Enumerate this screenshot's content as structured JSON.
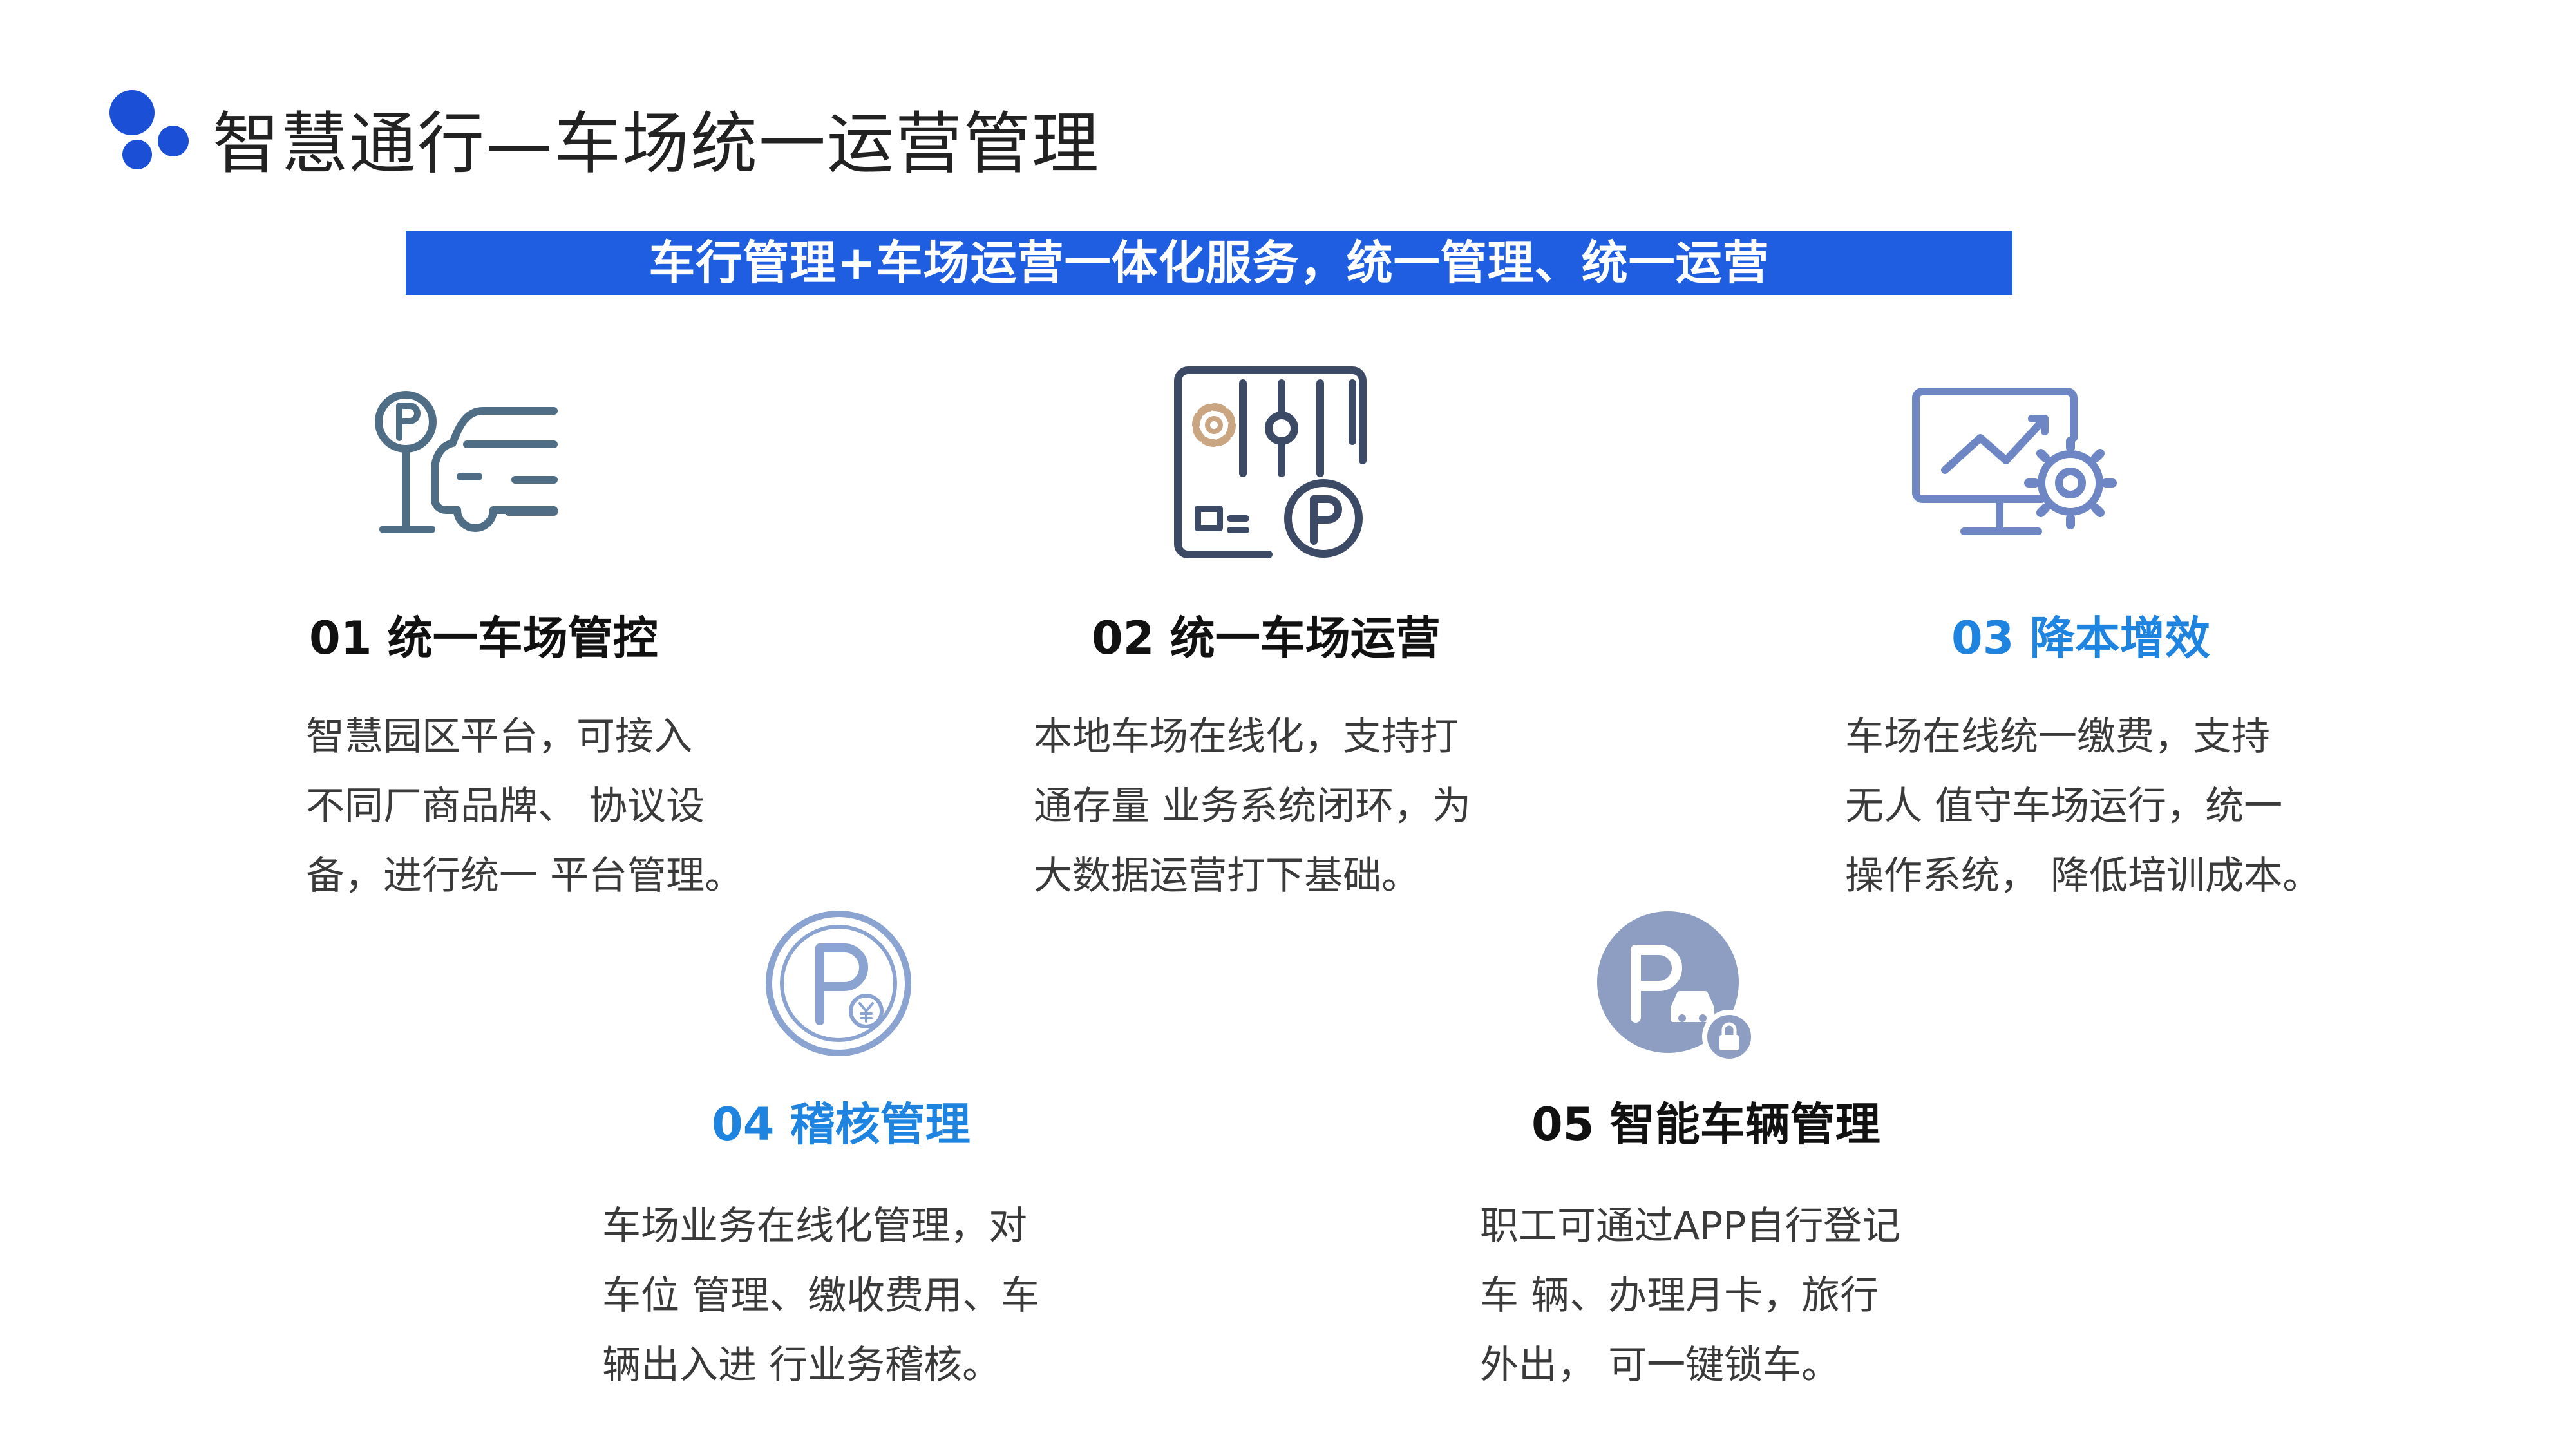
{
  "header": {
    "title": "智慧通行—车场统一运营管理"
  },
  "banner": {
    "text": "车行管理+车场运营一体化服务，统一管理、统一运营"
  },
  "colors": {
    "brand": "#1a4fd6",
    "banner": "#1f5ee0",
    "accent_title": "#1e84e0",
    "icon_gray_blue": "#4f6e86",
    "icon_navy": "#3d4a66",
    "icon_periwinkle": "#6f86c4",
    "icon_tan": "#c9a582",
    "icon_slate": "#8e9ec2"
  },
  "features": [
    {
      "title": "01 统一车场管控",
      "lines": [
        "智慧园区平台，可接入",
        "不同厂商品牌、 协议设",
        "备，进行统一 平台管理。"
      ],
      "icon": "parking-car-icon"
    },
    {
      "title": "02 统一车场运营",
      "lines": [
        "本地车场在线化，支持打",
        "通存量 业务系统闭环，为",
        "大数据运营打下基础。"
      ],
      "icon": "control-panel-parking-icon"
    },
    {
      "title": "03 降本增效",
      "lines": [
        "车场在线统一缴费，支持",
        "无人 值守车场运行，统一",
        "操作系统， 降低培训成本。"
      ],
      "icon": "monitor-chart-gear-icon"
    },
    {
      "title": "04 稽核管理",
      "lines": [
        "车场业务在线化管理，对",
        "车位 管理、缴收费用、车",
        "辆出入进 行业务稽核。"
      ],
      "icon": "parking-yuan-icon"
    },
    {
      "title": "05 智能车辆管理",
      "lines": [
        "职工可通过APP自行登记",
        "车 辆、办理月卡，旅行",
        "外出， 可一键锁车。"
      ],
      "icon": "parking-lock-icon"
    }
  ]
}
